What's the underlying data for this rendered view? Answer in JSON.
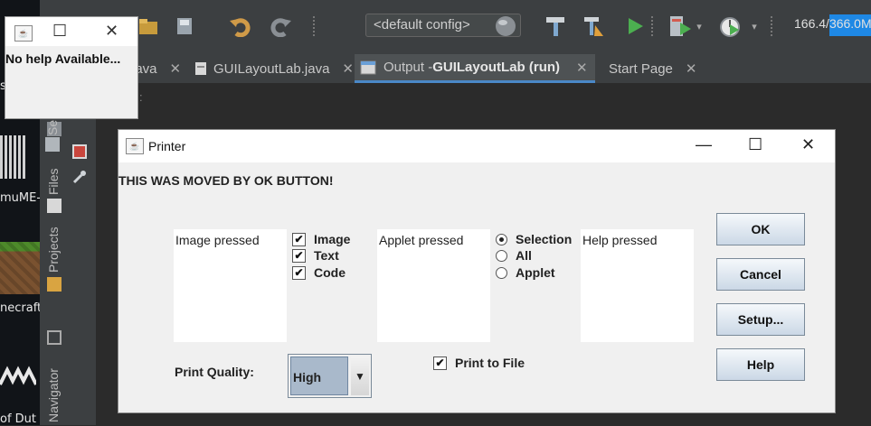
{
  "desktop": {
    "labels": [
      "s",
      "muME-",
      "necraft",
      "of Dut"
    ]
  },
  "ide": {
    "config_select": "<default config>",
    "memory": {
      "used": "166.4/",
      "total": "366.0M"
    },
    "tabs": [
      {
        "label": "java",
        "active": false
      },
      {
        "label": "GUILayoutLab.java",
        "active": false
      },
      {
        "label_prefix": "Output - ",
        "label_bold": "GUILayoutLab (run)",
        "active": true
      },
      {
        "label": "Start Page",
        "active": false
      }
    ],
    "tab_close": "✕",
    "sidebar": [
      "Se",
      "Files",
      "Projects",
      "Navigator"
    ],
    "output_partial": ":"
  },
  "help_window": {
    "message": "No help Available..."
  },
  "printer": {
    "title": "Printer",
    "moved_text": "THIS WAS MOVED BY OK BUTTON!",
    "text_areas": [
      "Image pressed",
      "Applet pressed",
      "Help pressed"
    ],
    "checkboxes": [
      {
        "label": "Image",
        "checked": true
      },
      {
        "label": "Text",
        "checked": true
      },
      {
        "label": "Code",
        "checked": true
      }
    ],
    "radios": [
      {
        "label": "Selection",
        "selected": true
      },
      {
        "label": "All",
        "selected": false
      },
      {
        "label": "Applet",
        "selected": false
      }
    ],
    "buttons": [
      "OK",
      "Cancel",
      "Setup...",
      "Help"
    ],
    "print_quality_label": "Print Quality:",
    "print_quality_value": "High",
    "print_to_file_label": "Print to File",
    "print_to_file_checked": true
  }
}
